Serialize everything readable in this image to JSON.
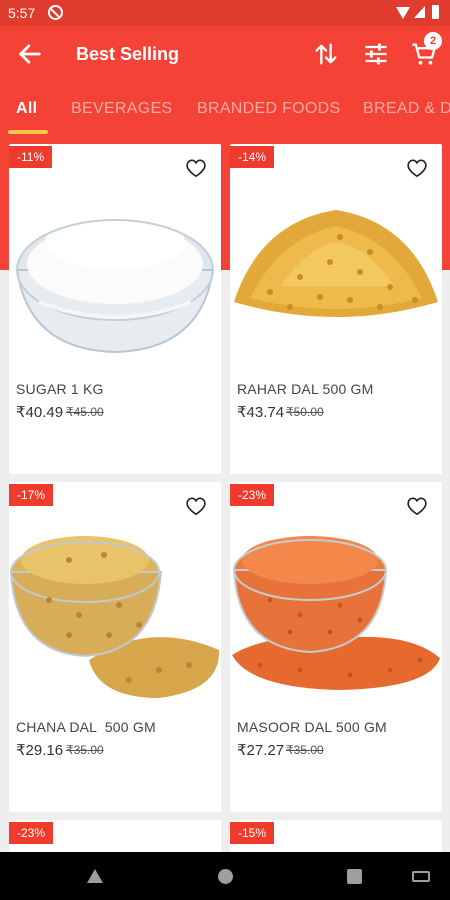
{
  "status_bar": {
    "time": "5:57"
  },
  "app_bar": {
    "title": "Best Selling",
    "cart_count": "2"
  },
  "tabs": [
    {
      "label": "All",
      "active": true
    },
    {
      "label": "BEVERAGES",
      "active": false
    },
    {
      "label": "BRANDED FOODS",
      "active": false
    },
    {
      "label": "BREAD & DA",
      "active": false
    }
  ],
  "products": [
    {
      "discount": "-11%",
      "name": "SUGAR 1 KG",
      "price": "₹40.49",
      "old_price": "₹45.00",
      "image": "sugar-bowl"
    },
    {
      "discount": "-14%",
      "name": "RAHAR DAL 500 GM",
      "price": "₹43.74",
      "old_price": "₹50.00",
      "image": "toor-dal-heap"
    },
    {
      "discount": "-17%",
      "name": "CHANA DAL  500 GM",
      "price": "₹29.16",
      "old_price": "₹35.00",
      "image": "chana-dal-bowl"
    },
    {
      "discount": "-23%",
      "name": "MASOOR DAL 500 GM",
      "price": "₹27.27",
      "old_price": "₹35.00",
      "image": "masoor-dal-bowl"
    },
    {
      "discount": "-23%"
    },
    {
      "discount": "-15%"
    }
  ],
  "colors": {
    "primary": "#f44336",
    "tab_indicator": "#f3c74a",
    "badge": "#ef3b2d"
  }
}
